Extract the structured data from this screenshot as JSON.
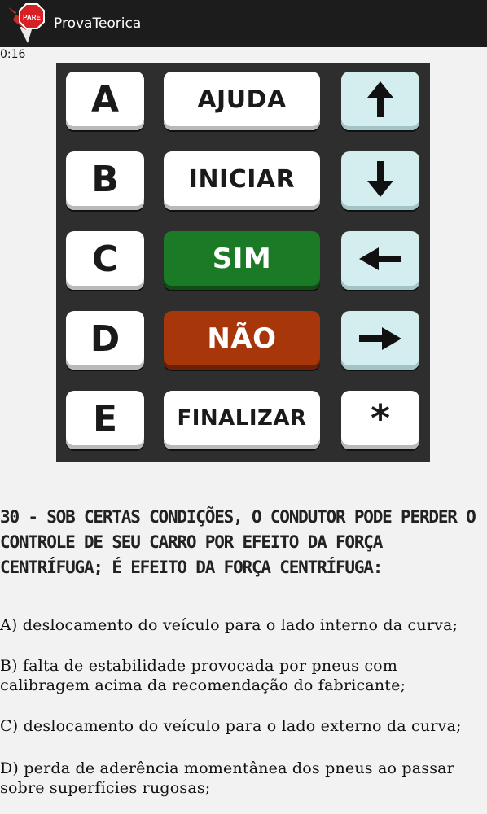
{
  "app": {
    "title": "ProvaTeorica",
    "icon": "stop-sign-icon",
    "icon_text": "PARE"
  },
  "timer": "0:16",
  "keypad": {
    "letters": [
      "A",
      "B",
      "C",
      "D",
      "E"
    ],
    "words": [
      "AJUDA",
      "INICIAR",
      "SIM",
      "NÃO",
      "FINALIZAR"
    ],
    "arrows": [
      "arrow-up-icon",
      "arrow-down-icon",
      "arrow-left-icon",
      "arrow-right-icon"
    ],
    "star": "*"
  },
  "question": {
    "text": "30 - SOB CERTAS CONDIÇÕES, O CONDUTOR PODE PERDER O CONTROLE DE SEU CARRO POR EFEITO DA FORÇA CENTRÍFUGA; É EFEITO DA FORÇA CENTRÍFUGA:"
  },
  "options": [
    "A) deslocamento do veículo para o lado interno da curva;",
    "B) falta de estabilidade provocada por pneus com calibragem acima da recomendação do fabricante;",
    "C) deslocamento do veículo para o lado externo da curva;",
    "D) perda de aderência momentânea dos pneus ao passar sobre superfícies rugosas;"
  ],
  "colors": {
    "actionbar": "#1c1c1c",
    "keypad_bg": "#2e2e2e",
    "sim": "#1b7a25",
    "nao": "#a8360b",
    "arrow_key": "#d4eef0"
  }
}
